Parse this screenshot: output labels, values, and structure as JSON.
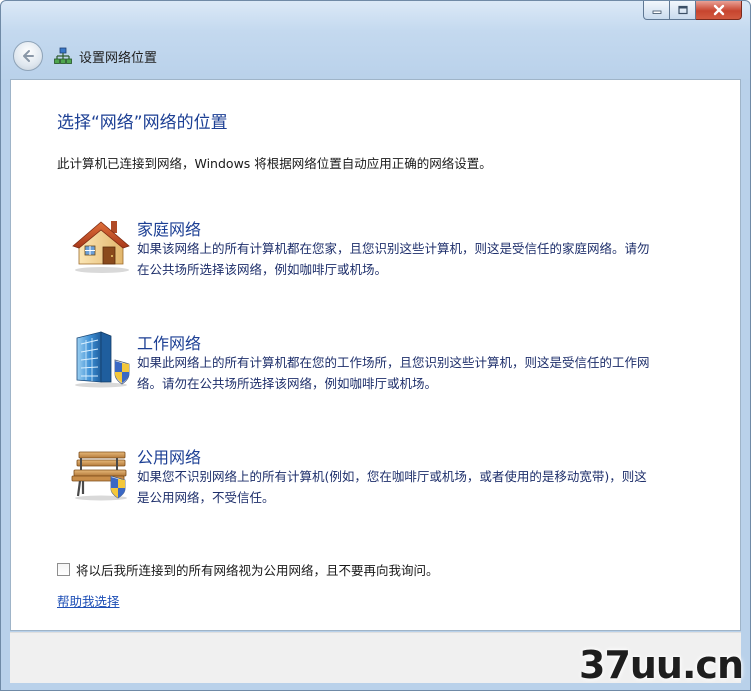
{
  "window": {
    "controls": {
      "minimize": "minimize",
      "maximize": "maximize",
      "close": "close"
    }
  },
  "nav": {
    "title": "设置网络位置"
  },
  "main": {
    "heading": "选择“网络”网络的位置",
    "intro": "此计算机已连接到网络，Windows 将根据网络位置自动应用正确的网络设置。",
    "options": [
      {
        "title": "家庭网络",
        "desc": "如果该网络上的所有计算机都在您家，且您识别这些计算机，则这是受信任的家庭网络。请勿在公共场所选择该网络，例如咖啡厅或机场。",
        "icon": "house-icon"
      },
      {
        "title": "工作网络",
        "desc": "如果此网络上的所有计算机都在您的工作场所，且您识别这些计算机，则这是受信任的工作网络。请勿在公共场所选择该网络，例如咖啡厅或机场。",
        "icon": "office-building-icon"
      },
      {
        "title": "公用网络",
        "desc": "如果您不识别网络上的所有计算机(例如，您在咖啡厅或机场，或者使用的是移动宽带)，则这是公用网络，不受信任。",
        "icon": "park-bench-icon"
      }
    ],
    "checkbox_label": "将以后我所连接到的所有网络视为公用网络，且不要再向我询问。",
    "checkbox_checked": false,
    "help_link": "帮助我选择"
  },
  "watermark": "37uu.cn",
  "colors": {
    "heading": "#1c3f94",
    "link": "#1e4fb6",
    "desc": "#1e2f6b"
  }
}
